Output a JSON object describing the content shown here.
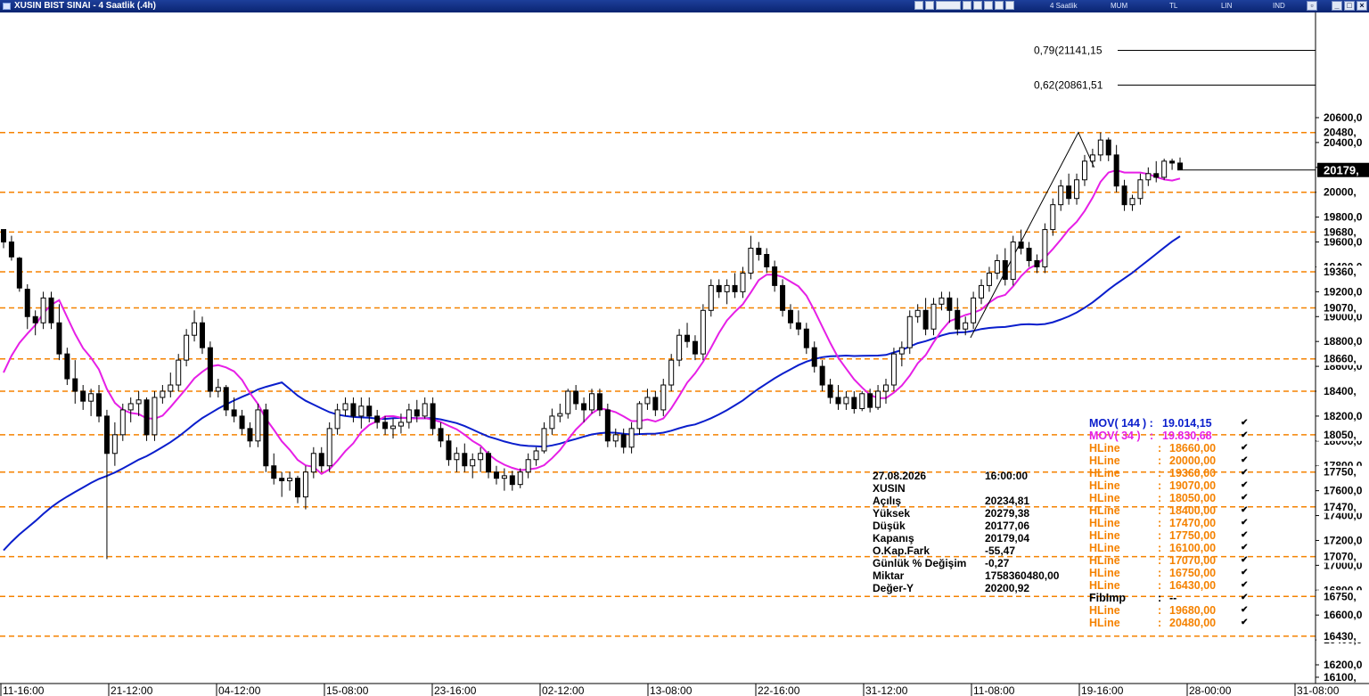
{
  "window": {
    "title": "XUSIN BIST SINAI - 4 Saatlik (.4h)",
    "toolbar_labels": [
      "4 Saatlik",
      "MUM",
      "TL",
      "LIN",
      "IND"
    ]
  },
  "chart_data": {
    "type": "candlestick",
    "period_label": "4 Saatlik",
    "y_axis": {
      "ticks": [
        20600,
        20400,
        20200,
        20000,
        19800,
        19600,
        19400,
        19200,
        19000,
        18800,
        18600,
        18400,
        18200,
        18000,
        17800,
        17600,
        17400,
        17200,
        17000,
        16800,
        16600,
        16400,
        16200,
        16100
      ],
      "tick_labels": [
        "20600,0",
        "20400,0",
        "20200,0",
        "20000,0",
        "19800,0",
        "19600,0",
        "19400,0",
        "19200,0",
        "19000,0",
        "18800,0",
        "18600,0",
        "18400,0",
        "18200,0",
        "18000,0",
        "17800,0",
        "17600,0",
        "17400,0",
        "17200,0",
        "17000,0",
        "16800,0",
        "16600,0",
        "16400,0",
        "16200,0",
        "16100,"
      ],
      "range": [
        16100,
        21300
      ]
    },
    "x_axis": {
      "labels": [
        "11-16:00",
        "21-12:00",
        "04-12:00",
        "15-08:00",
        "23-16:00",
        "02-12:00",
        "13-08:00",
        "22-16:00",
        "31-12:00",
        "11-08:00",
        "19-16:00",
        "28-00:00",
        "31-08:00"
      ]
    },
    "last_price_label": "20179,",
    "horizontal_lines": [
      {
        "label": "20480,",
        "value": 20480
      },
      {
        "label": "20000,",
        "value": 20000
      },
      {
        "label": "19680,",
        "value": 19680
      },
      {
        "label": "19360,",
        "value": 19360
      },
      {
        "label": "19070,",
        "value": 19070
      },
      {
        "label": "18660,",
        "value": 18660
      },
      {
        "label": "18400,",
        "value": 18400
      },
      {
        "label": "18050,",
        "value": 18050
      },
      {
        "label": "17750,",
        "value": 17750
      },
      {
        "label": "17470,",
        "value": 17470
      },
      {
        "label": "17070,",
        "value": 17070
      },
      {
        "label": "16750,",
        "value": 16750
      },
      {
        "label": "16430,",
        "value": 16430
      }
    ],
    "fib_levels": [
      {
        "label": "0,79(21141,15",
        "value": 21141.15
      },
      {
        "label": "0,62(20861,51",
        "value": 20861.51
      }
    ],
    "trend_line": [
      [
        0.735,
        18830
      ],
      [
        0.817,
        20480
      ],
      [
        0.829,
        20200
      ]
    ],
    "candles": [
      [
        0,
        19700,
        19700,
        19550,
        19600
      ],
      [
        1,
        19600,
        19650,
        19450,
        19480
      ],
      [
        2,
        19470,
        19480,
        19200,
        19230
      ],
      [
        3,
        19220,
        19260,
        18900,
        19000
      ],
      [
        4,
        19000,
        19050,
        18850,
        18950
      ],
      [
        5,
        18950,
        19200,
        18900,
        19150
      ],
      [
        6,
        19150,
        19200,
        18900,
        18950
      ],
      [
        7,
        18950,
        19100,
        18650,
        18700
      ],
      [
        8,
        18700,
        18750,
        18450,
        18500
      ],
      [
        9,
        18500,
        18650,
        18300,
        18400
      ],
      [
        10,
        18400,
        18450,
        18250,
        18320
      ],
      [
        11,
        18320,
        18420,
        18200,
        18380
      ],
      [
        12,
        18380,
        18450,
        18150,
        18200
      ],
      [
        13,
        18200,
        18250,
        17050,
        17900
      ],
      [
        14,
        17900,
        18150,
        17800,
        18050
      ],
      [
        15,
        18050,
        18300,
        18000,
        18250
      ],
      [
        16,
        18250,
        18350,
        18150,
        18300
      ],
      [
        17,
        18300,
        18400,
        18200,
        18330
      ],
      [
        18,
        18330,
        18350,
        18000,
        18050
      ],
      [
        19,
        18050,
        18400,
        18000,
        18350
      ],
      [
        20,
        18350,
        18450,
        18300,
        18400
      ],
      [
        21,
        18400,
        18550,
        18350,
        18450
      ],
      [
        22,
        18450,
        18700,
        18400,
        18650
      ],
      [
        23,
        18650,
        18900,
        18600,
        18850
      ],
      [
        24,
        18850,
        19050,
        18800,
        18950
      ],
      [
        25,
        18950,
        19000,
        18700,
        18750
      ],
      [
        26,
        18750,
        18800,
        18350,
        18400
      ],
      [
        27,
        18400,
        18500,
        18350,
        18430
      ],
      [
        28,
        18430,
        18450,
        18200,
        18250
      ],
      [
        29,
        18250,
        18350,
        18150,
        18200
      ],
      [
        30,
        18200,
        18250,
        18050,
        18100
      ],
      [
        31,
        18100,
        18150,
        17950,
        18000
      ],
      [
        32,
        18000,
        18300,
        17950,
        18250
      ],
      [
        33,
        18250,
        18300,
        17750,
        17800
      ],
      [
        34,
        17800,
        17900,
        17650,
        17700
      ],
      [
        35,
        17700,
        17750,
        17550,
        17680
      ],
      [
        36,
        17680,
        17750,
        17600,
        17700
      ],
      [
        37,
        17700,
        17720,
        17500,
        17550
      ],
      [
        38,
        17550,
        17800,
        17450,
        17750
      ],
      [
        39,
        17750,
        17950,
        17700,
        17900
      ],
      [
        40,
        17900,
        17950,
        17750,
        17800
      ],
      [
        41,
        17800,
        18150,
        17750,
        18100
      ],
      [
        42,
        18100,
        18300,
        18050,
        18250
      ],
      [
        43,
        18250,
        18350,
        18200,
        18300
      ],
      [
        44,
        18300,
        18350,
        18150,
        18200
      ],
      [
        45,
        18200,
        18350,
        18100,
        18280
      ],
      [
        46,
        18280,
        18350,
        18150,
        18200
      ],
      [
        47,
        18200,
        18250,
        18100,
        18150
      ],
      [
        48,
        18150,
        18200,
        18050,
        18100
      ],
      [
        49,
        18100,
        18180,
        18020,
        18120
      ],
      [
        50,
        18120,
        18220,
        18060,
        18150
      ],
      [
        51,
        18150,
        18300,
        18100,
        18250
      ],
      [
        52,
        18250,
        18330,
        18150,
        18200
      ],
      [
        53,
        18200,
        18350,
        18180,
        18300
      ],
      [
        54,
        18300,
        18350,
        18050,
        18100
      ],
      [
        55,
        18100,
        18150,
        17950,
        18000
      ],
      [
        56,
        18000,
        18050,
        17800,
        17850
      ],
      [
        57,
        17850,
        17950,
        17750,
        17900
      ],
      [
        58,
        17900,
        17980,
        17750,
        17800
      ],
      [
        59,
        17800,
        17900,
        17700,
        17850
      ],
      [
        60,
        17850,
        17950,
        17750,
        17900
      ],
      [
        61,
        17900,
        17920,
        17700,
        17750
      ],
      [
        62,
        17750,
        17800,
        17650,
        17700
      ],
      [
        63,
        17700,
        17780,
        17600,
        17720
      ],
      [
        64,
        17720,
        17760,
        17600,
        17650
      ],
      [
        65,
        17650,
        17780,
        17620,
        17750
      ],
      [
        66,
        17750,
        17900,
        17700,
        17850
      ],
      [
        67,
        17850,
        17950,
        17800,
        17920
      ],
      [
        68,
        17920,
        18150,
        17900,
        18100
      ],
      [
        69,
        18100,
        18260,
        18050,
        18200
      ],
      [
        70,
        18200,
        18300,
        18150,
        18220
      ],
      [
        71,
        18220,
        18420,
        18180,
        18400
      ],
      [
        72,
        18400,
        18450,
        18250,
        18300
      ],
      [
        73,
        18300,
        18350,
        18150,
        18250
      ],
      [
        74,
        18250,
        18420,
        18220,
        18380
      ],
      [
        75,
        18380,
        18420,
        18200,
        18250
      ],
      [
        76,
        18250,
        18300,
        17950,
        18000
      ],
      [
        77,
        18000,
        18100,
        17950,
        18050
      ],
      [
        78,
        18050,
        18100,
        17900,
        17950
      ],
      [
        79,
        17950,
        18150,
        17900,
        18100
      ],
      [
        80,
        18100,
        18320,
        18050,
        18300
      ],
      [
        81,
        18300,
        18420,
        18250,
        18350
      ],
      [
        82,
        18350,
        18400,
        18200,
        18250
      ],
      [
        83,
        18250,
        18500,
        18200,
        18450
      ],
      [
        84,
        18450,
        18700,
        18400,
        18650
      ],
      [
        85,
        18650,
        18900,
        18600,
        18850
      ],
      [
        86,
        18850,
        18950,
        18750,
        18800
      ],
      [
        87,
        18800,
        18850,
        18650,
        18700
      ],
      [
        88,
        18700,
        19100,
        18650,
        19050
      ],
      [
        89,
        19050,
        19300,
        19000,
        19250
      ],
      [
        90,
        19250,
        19300,
        19150,
        19200
      ],
      [
        91,
        19200,
        19300,
        19100,
        19250
      ],
      [
        92,
        19250,
        19350,
        19150,
        19200
      ],
      [
        93,
        19200,
        19400,
        19150,
        19350
      ],
      [
        94,
        19350,
        19650,
        19300,
        19550
      ],
      [
        95,
        19550,
        19600,
        19450,
        19500
      ],
      [
        96,
        19500,
        19550,
        19350,
        19400
      ],
      [
        97,
        19400,
        19450,
        19200,
        19250
      ],
      [
        98,
        19250,
        19300,
        19000,
        19050
      ],
      [
        99,
        19050,
        19100,
        18900,
        18950
      ],
      [
        100,
        18950,
        19050,
        18850,
        18900
      ],
      [
        101,
        18900,
        18950,
        18700,
        18750
      ],
      [
        102,
        18750,
        18800,
        18550,
        18600
      ],
      [
        103,
        18600,
        18650,
        18400,
        18450
      ],
      [
        104,
        18450,
        18500,
        18300,
        18350
      ],
      [
        105,
        18350,
        18450,
        18250,
        18300
      ],
      [
        106,
        18300,
        18400,
        18250,
        18350
      ],
      [
        107,
        18350,
        18400,
        18220,
        18260
      ],
      [
        108,
        18260,
        18400,
        18240,
        18380
      ],
      [
        109,
        18380,
        18420,
        18230,
        18270
      ],
      [
        110,
        18270,
        18450,
        18250,
        18400
      ],
      [
        111,
        18400,
        18500,
        18300,
        18450
      ],
      [
        112,
        18450,
        18750,
        18400,
        18700
      ],
      [
        113,
        18700,
        18800,
        18600,
        18750
      ],
      [
        114,
        18750,
        19050,
        18700,
        19000
      ],
      [
        115,
        19000,
        19100,
        18950,
        19050
      ],
      [
        116,
        19050,
        19150,
        18850,
        18900
      ],
      [
        117,
        18900,
        19150,
        18850,
        19100
      ],
      [
        118,
        19100,
        19200,
        19050,
        19150
      ],
      [
        119,
        19150,
        19200,
        18950,
        19050
      ],
      [
        120,
        19050,
        19150,
        18850,
        18900
      ],
      [
        121,
        18900,
        19000,
        18850,
        18950
      ],
      [
        122,
        18950,
        19200,
        18900,
        19150
      ],
      [
        123,
        19150,
        19300,
        19100,
        19250
      ],
      [
        124,
        19250,
        19400,
        19200,
        19350
      ],
      [
        125,
        19350,
        19500,
        19300,
        19450
      ],
      [
        126,
        19450,
        19550,
        19250,
        19300
      ],
      [
        127,
        19300,
        19650,
        19250,
        19600
      ],
      [
        128,
        19600,
        19700,
        19500,
        19550
      ],
      [
        129,
        19550,
        19600,
        19400,
        19450
      ],
      [
        130,
        19450,
        19500,
        19350,
        19400
      ],
      [
        131,
        19400,
        19750,
        19350,
        19700
      ],
      [
        132,
        19700,
        19950,
        19650,
        19900
      ],
      [
        133,
        19900,
        20100,
        19850,
        20050
      ],
      [
        134,
        20050,
        20150,
        19900,
        19950
      ],
      [
        135,
        19950,
        20150,
        19900,
        20100
      ],
      [
        136,
        20100,
        20300,
        20050,
        20250
      ],
      [
        137,
        20250,
        20350,
        20200,
        20300
      ],
      [
        138,
        20300,
        20480,
        20250,
        20420
      ],
      [
        139,
        20420,
        20440,
        20250,
        20300
      ],
      [
        140,
        20300,
        20380,
        20000,
        20050
      ],
      [
        141,
        20050,
        20100,
        19850,
        19900
      ],
      [
        142,
        19900,
        19980,
        19850,
        19950
      ],
      [
        143,
        19950,
        20150,
        19900,
        20100
      ],
      [
        144,
        20100,
        20200,
        20050,
        20150
      ],
      [
        145,
        20150,
        20250,
        20080,
        20120
      ],
      [
        146,
        20120,
        20270,
        20100,
        20250
      ],
      [
        147,
        20250,
        20270,
        20180,
        20234.81
      ],
      [
        148,
        20234.81,
        20279.38,
        20177.06,
        20179.04
      ]
    ],
    "indicators": [
      {
        "name": "MOV( 144 )",
        "value": "19.014,15",
        "color": "#0a1ecc"
      },
      {
        "name": "MOV( 34 )",
        "value": "19.830,68",
        "color": "#e61fe6"
      }
    ]
  },
  "info_panel": {
    "rows": [
      {
        "k": "27.08.2026",
        "v": "16:00:00"
      },
      {
        "k": "XUSIN",
        "v": ""
      },
      {
        "k": "Açılış",
        "v": "20234,81"
      },
      {
        "k": "Yüksek",
        "v": "20279,38"
      },
      {
        "k": "Düşük",
        "v": "20177,06"
      },
      {
        "k": "Kapanış",
        "v": "20179,04"
      },
      {
        "k": "O.Kap.Fark",
        "v": "-55,47"
      },
      {
        "k": "Günlük % Değişim",
        "v": "-0,27"
      },
      {
        "k": "Miktar",
        "v": "1758360480,00"
      },
      {
        "k": "Değer-Y",
        "v": "20200,92"
      }
    ]
  },
  "legend": {
    "rows": [
      {
        "name": "MOV( 144",
        "colon": ") :",
        "value": "19.014,15",
        "color": "#0a1ecc"
      },
      {
        "name": "MOV( 34 )",
        "colon": ":",
        "value": "19.830,68",
        "color": "#e61fe6"
      },
      {
        "name": "HLine",
        "colon": ":",
        "value": "18660,00",
        "color": "#f58200"
      },
      {
        "name": "HLine",
        "colon": ":",
        "value": "20000,00",
        "color": "#f58200"
      },
      {
        "name": "HLine",
        "colon": ":",
        "value": "19360,00",
        "color": "#f58200"
      },
      {
        "name": "HLine",
        "colon": ":",
        "value": "19070,00",
        "color": "#f58200"
      },
      {
        "name": "HLine",
        "colon": ":",
        "value": "18050,00",
        "color": "#f58200"
      },
      {
        "name": "HLine",
        "colon": ":",
        "value": "18400,00",
        "color": "#f58200"
      },
      {
        "name": "HLine",
        "colon": ":",
        "value": "17470,00",
        "color": "#f58200"
      },
      {
        "name": "HLine",
        "colon": ":",
        "value": "17750,00",
        "color": "#f58200"
      },
      {
        "name": "HLine",
        "colon": ":",
        "value": "16100,00",
        "color": "#f58200"
      },
      {
        "name": "HLine",
        "colon": ":",
        "value": "17070,00",
        "color": "#f58200"
      },
      {
        "name": "HLine",
        "colon": ":",
        "value": "16750,00",
        "color": "#f58200"
      },
      {
        "name": "HLine",
        "colon": ":",
        "value": "16430,00",
        "color": "#f58200"
      },
      {
        "name": "FibImp",
        "colon": ":",
        "value": "--",
        "color": "#000000"
      },
      {
        "name": "HLine",
        "colon": ":",
        "value": "19680,00",
        "color": "#f58200"
      },
      {
        "name": "HLine",
        "colon": ":",
        "value": "20480,00",
        "color": "#f58200"
      }
    ],
    "check_glyph": "✔"
  },
  "colors": {
    "hline": "#f58200",
    "ma34": "#e61fe6",
    "ma144": "#0a1ecc",
    "titlebar": "#0a2470",
    "last_price_bg": "#000000"
  }
}
